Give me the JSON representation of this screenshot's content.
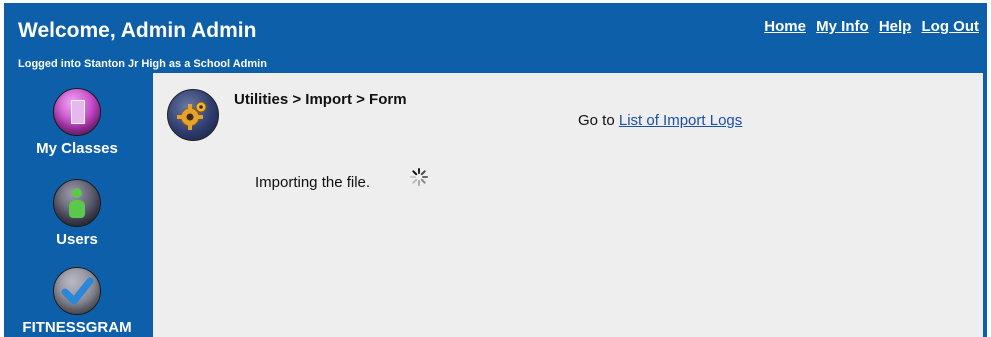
{
  "header": {
    "welcome": "Welcome, Admin Admin",
    "logged_in": "Logged into Stanton Jr High as a School Admin",
    "links": {
      "home": "Home",
      "my_info": "My Info",
      "help": "Help",
      "log_out": "Log Out"
    }
  },
  "sidebar": {
    "items": [
      {
        "label": "My Classes",
        "icon": "classroom-door-icon",
        "color": "#c03fc4"
      },
      {
        "label": "Users",
        "icon": "user-icon",
        "color": "#5ac84a"
      },
      {
        "label": "FITNESSGRAM",
        "icon": "checkmark-icon",
        "color": "#2a86d8"
      }
    ]
  },
  "content": {
    "breadcrumb": "Utilities > Import > Form",
    "goto_prefix": "Go to",
    "goto_link": "List of Import Logs",
    "status": "Importing the file.",
    "utility_icon": "gear-icon"
  },
  "colors": {
    "frame": "#0c5fa8",
    "panel": "#eeeeee",
    "link": "#1d4fa5"
  }
}
